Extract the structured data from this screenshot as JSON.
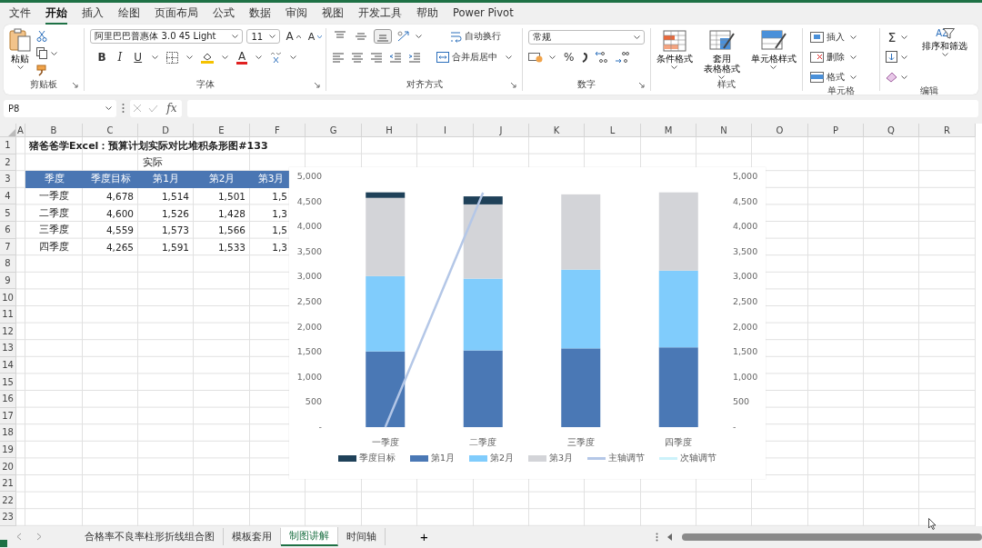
{
  "menu_tabs": [
    {
      "label": "文件",
      "selected": false
    },
    {
      "label": "开始",
      "selected": true
    },
    {
      "label": "插入",
      "selected": false
    },
    {
      "label": "绘图",
      "selected": false
    },
    {
      "label": "页面布局",
      "selected": false
    },
    {
      "label": "公式",
      "selected": false
    },
    {
      "label": "数据",
      "selected": false
    },
    {
      "label": "审阅",
      "selected": false
    },
    {
      "label": "视图",
      "selected": false
    },
    {
      "label": "开发工具",
      "selected": false
    },
    {
      "label": "帮助",
      "selected": false
    },
    {
      "label": "Power Pivot",
      "selected": false
    }
  ],
  "ribbon": {
    "clipboard": {
      "label": "剪贴板",
      "paste": "粘贴"
    },
    "font": {
      "label": "字体",
      "name": "阿里巴巴普惠体 3.0 45 Light",
      "size": "11",
      "grow": "A",
      "shrink": "A",
      "bold": "B",
      "italic": "I",
      "underline": "U",
      "color_letter": "A"
    },
    "alignment": {
      "label": "对齐方式",
      "vertical": [
        {
          "kind": "top",
          "selected": false
        },
        {
          "kind": "middle",
          "selected": false
        },
        {
          "kind": "bottom",
          "selected": true
        }
      ],
      "wrap": "自动换行",
      "merge": "合并后居中"
    },
    "number": {
      "label": "数字",
      "format": "常规",
      "percent": "%"
    },
    "styles": {
      "label": "样式",
      "buttons": [
        {
          "lines": [
            "条件格式"
          ]
        },
        {
          "lines": [
            "套用",
            "表格格式"
          ]
        },
        {
          "lines": [
            "单元格样式"
          ]
        }
      ]
    },
    "cells": {
      "label": "单元格",
      "buttons": [
        "插入",
        "删除",
        "格式"
      ]
    },
    "editing": {
      "label": "编辑",
      "sum": "Σ",
      "sort_glyph": "AZ",
      "sort": "排序和筛选"
    }
  },
  "formula_bar": {
    "name_box": "P8",
    "fx": "fx"
  },
  "sheet": {
    "columns": [
      "A",
      "B",
      "C",
      "D",
      "E",
      "F",
      "G",
      "H",
      "I",
      "J",
      "K",
      "L",
      "M",
      "N",
      "O",
      "P",
      "Q",
      "R"
    ],
    "rows": [
      "1",
      "2",
      "3",
      "4",
      "5",
      "6",
      "7",
      "8",
      "9",
      "10",
      "11",
      "12",
      "13",
      "14",
      "15",
      "16",
      "17",
      "18",
      "19",
      "20",
      "21",
      "22",
      "23"
    ],
    "title": "猪爸爸学Excel：预算计划实际对比堆积条形图#133",
    "group_label": "实际",
    "table": {
      "columns": [
        "季度",
        "季度目标",
        "第1月",
        "第2月",
        "第3月"
      ],
      "rows": [
        [
          "一季度",
          "4,678",
          "1,514",
          "1,501",
          "1,5"
        ],
        [
          "二季度",
          "4,600",
          "1,526",
          "1,428",
          "1,3"
        ],
        [
          "三季度",
          "4,559",
          "1,573",
          "1,566",
          "1,5"
        ],
        [
          "四季度",
          "4,265",
          "1,591",
          "1,533",
          "1,3"
        ]
      ]
    },
    "chart_data": {
      "type": "bar",
      "stacked": true,
      "legend": "bottom",
      "categories": [
        "一季度",
        "二季度",
        "三季度",
        "四季度"
      ],
      "ylim": [
        0,
        5000
      ],
      "yticks": [
        {
          "value": 0,
          "label": "-"
        },
        {
          "value": 500,
          "label": "500"
        },
        {
          "value": 1000,
          "label": "1,000"
        },
        {
          "value": 1500,
          "label": "1,500"
        },
        {
          "value": 2000,
          "label": "2,000"
        },
        {
          "value": 2500,
          "label": "2,500"
        },
        {
          "value": 3000,
          "label": "3,000"
        },
        {
          "value": 3500,
          "label": "3,500"
        },
        {
          "value": 4000,
          "label": "4,000"
        },
        {
          "value": 4500,
          "label": "4,500"
        },
        {
          "value": 5000,
          "label": "5,000"
        }
      ],
      "series": [
        {
          "name": "季度目标",
          "color": "#1f4159",
          "values": [
            110,
            160,
            0,
            0
          ]
        },
        {
          "name": "第1月",
          "color": "#4a78b5",
          "values": [
            1510,
            1530,
            1570,
            1590
          ]
        },
        {
          "name": "第2月",
          "color": "#80ccfc",
          "values": [
            1500,
            1430,
            1570,
            1530
          ]
        },
        {
          "name": "第3月",
          "color": "#d3d4d8",
          "values": [
            1560,
            1480,
            1500,
            1560
          ]
        }
      ],
      "ref_lines": [
        {
          "label": "主轴调节",
          "color": "#b4c7e7"
        },
        {
          "label": "次轴调节",
          "color": "#ccf2fa"
        }
      ]
    }
  },
  "sheet_tabs": [
    {
      "label": "合格率不良率柱形折线组合图",
      "selected": false
    },
    {
      "label": "模板套用",
      "selected": false
    },
    {
      "label": "制图讲解",
      "selected": true
    },
    {
      "label": "时间轴",
      "selected": false
    }
  ],
  "add_sheet": "+"
}
